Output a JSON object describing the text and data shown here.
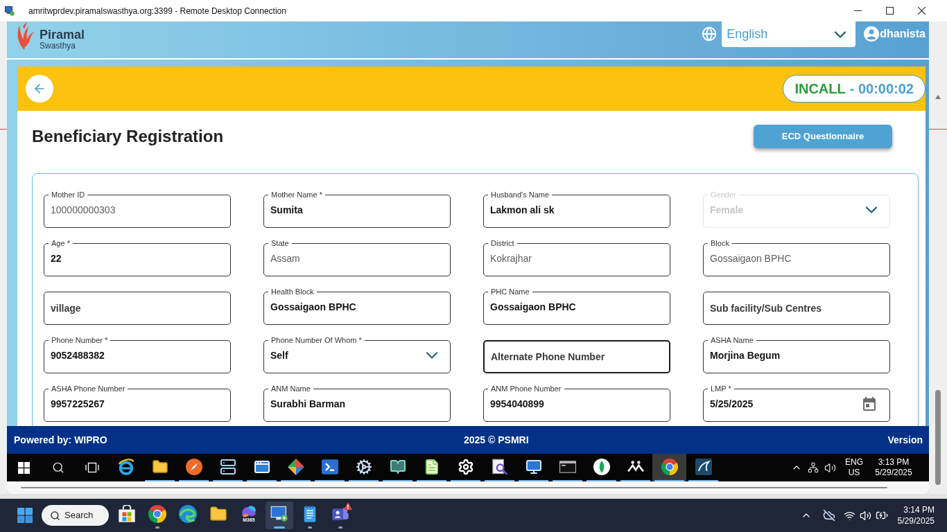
{
  "window": {
    "title": "amritwprdev.piramalswasthya.org:3399 - Remote Desktop Connection"
  },
  "app_header": {
    "logo": {
      "name": "Piramal",
      "tagline": "Swasthya"
    },
    "language": {
      "value": "English"
    },
    "user": {
      "name": "dhanista"
    }
  },
  "call_bar": {
    "status": "INCALL",
    "timer": "- 00:00:02"
  },
  "page": {
    "title": "Beneficiary Registration",
    "action_button": "ECD Questionnaire"
  },
  "form": {
    "fields": [
      {
        "kind": "text",
        "label": "Mother ID",
        "value": "100000000303",
        "readonly": true,
        "disabled": false,
        "focused": false
      },
      {
        "kind": "text",
        "label": "Mother Name *",
        "value": "Sumita",
        "readonly": false,
        "disabled": false,
        "focused": false
      },
      {
        "kind": "text",
        "label": "Husband's Name",
        "value": "Lakmon ali sk",
        "readonly": false,
        "disabled": false,
        "focused": false
      },
      {
        "kind": "select",
        "label": "Gender",
        "value": "Female",
        "readonly": false,
        "disabled": true,
        "focused": false
      },
      {
        "kind": "text",
        "label": "Age *",
        "value": "22",
        "readonly": false,
        "disabled": false,
        "focused": false
      },
      {
        "kind": "text",
        "label": "State",
        "value": "Assam",
        "readonly": true,
        "disabled": false,
        "focused": false
      },
      {
        "kind": "text",
        "label": "District",
        "value": "Kokrajhar",
        "readonly": true,
        "disabled": false,
        "focused": false
      },
      {
        "kind": "text",
        "label": "Block",
        "value": "Gossaigaon BPHC",
        "readonly": true,
        "disabled": false,
        "focused": false
      },
      {
        "kind": "text",
        "placeholder": "village",
        "readonly": false,
        "disabled": false,
        "focused": false
      },
      {
        "kind": "text",
        "label": "Health Block",
        "value": "Gossaigaon BPHC",
        "readonly": false,
        "disabled": false,
        "focused": false
      },
      {
        "kind": "text",
        "label": "PHC Name",
        "value": "Gossaigaon BPHC",
        "readonly": false,
        "disabled": false,
        "focused": false
      },
      {
        "kind": "text",
        "placeholder": "Sub facility/Sub Centres",
        "readonly": false,
        "disabled": false,
        "focused": false
      },
      {
        "kind": "text",
        "label": "Phone Number *",
        "value": "9052488382",
        "readonly": false,
        "disabled": false,
        "focused": false
      },
      {
        "kind": "select",
        "label": "Phone Number Of Whom *",
        "value": "Self",
        "readonly": false,
        "disabled": false,
        "focused": false
      },
      {
        "kind": "text",
        "placeholder": "Alternate Phone Number",
        "readonly": false,
        "disabled": false,
        "focused": true
      },
      {
        "kind": "text",
        "label": "ASHA Name",
        "value": "Morjina Begum",
        "readonly": false,
        "disabled": false,
        "focused": false
      },
      {
        "kind": "text",
        "label": "ASHA Phone Number",
        "value": "9957225267",
        "readonly": false,
        "disabled": false,
        "focused": false
      },
      {
        "kind": "text",
        "label": "ANM Name",
        "value": "Surabhi Barman",
        "readonly": false,
        "disabled": false,
        "focused": false
      },
      {
        "kind": "text",
        "label": "ANM Phone Number",
        "value": "9954040899",
        "readonly": false,
        "disabled": false,
        "focused": false
      },
      {
        "kind": "date",
        "label": "LMP *",
        "value": "5/25/2025",
        "readonly": false,
        "disabled": false,
        "focused": false
      }
    ]
  },
  "footer": {
    "powered_by": "Powered by: WIPRO",
    "copyright": "2025 © PSMRI",
    "version": "Version"
  },
  "remote_taskbar": {
    "apps": [
      {
        "kind": "ring",
        "running": false,
        "active": false
      },
      {
        "kind": "folder",
        "running": true,
        "active": false
      },
      {
        "kind": "compass",
        "running": true,
        "active": false
      },
      {
        "kind": "server",
        "running": true,
        "active": false
      },
      {
        "kind": "window",
        "running": true,
        "active": false
      },
      {
        "kind": "diamond",
        "running": true,
        "active": false
      },
      {
        "kind": "terminal",
        "running": true,
        "active": false
      },
      {
        "kind": "gears",
        "running": true,
        "active": false
      },
      {
        "kind": "book",
        "running": true,
        "active": false
      },
      {
        "kind": "chart",
        "running": true,
        "active": false
      },
      {
        "kind": "gear",
        "running": true,
        "active": false
      },
      {
        "kind": "magnifier",
        "running": true,
        "active": false
      },
      {
        "kind": "monitor",
        "running": true,
        "active": false
      },
      {
        "kind": "console",
        "running": true,
        "active": false
      },
      {
        "kind": "leaf",
        "running": true,
        "active": false
      },
      {
        "kind": "figure",
        "running": true,
        "active": false
      },
      {
        "kind": "round-browser",
        "running": true,
        "active": true
      },
      {
        "kind": "dolphin",
        "running": true,
        "active": false
      }
    ],
    "language": {
      "line_1": "ENG",
      "line_2": "US"
    },
    "clock": {
      "time": "3:13 PM",
      "date": "5/29/2025"
    }
  },
  "taskbar": {
    "search": "Search",
    "apps": [
      {
        "kind": "store",
        "running": false,
        "active": false,
        "alert": false
      },
      {
        "kind": "round-browser",
        "running": true,
        "active": false,
        "alert": false
      },
      {
        "kind": "swirl",
        "running": false,
        "active": false,
        "alert": false
      },
      {
        "kind": "folder",
        "running": false,
        "active": false,
        "alert": false
      },
      {
        "kind": "blob",
        "label": "M365",
        "running": false,
        "active": false,
        "alert": false
      },
      {
        "kind": "monitor",
        "running": true,
        "active": true,
        "alert": false
      },
      {
        "kind": "notepad",
        "running": true,
        "active": false,
        "alert": false
      },
      {
        "kind": "people",
        "running": true,
        "active": false,
        "alert": true
      }
    ],
    "clock": {
      "time": "3:14 PM",
      "date": "5/29/2025"
    }
  }
}
